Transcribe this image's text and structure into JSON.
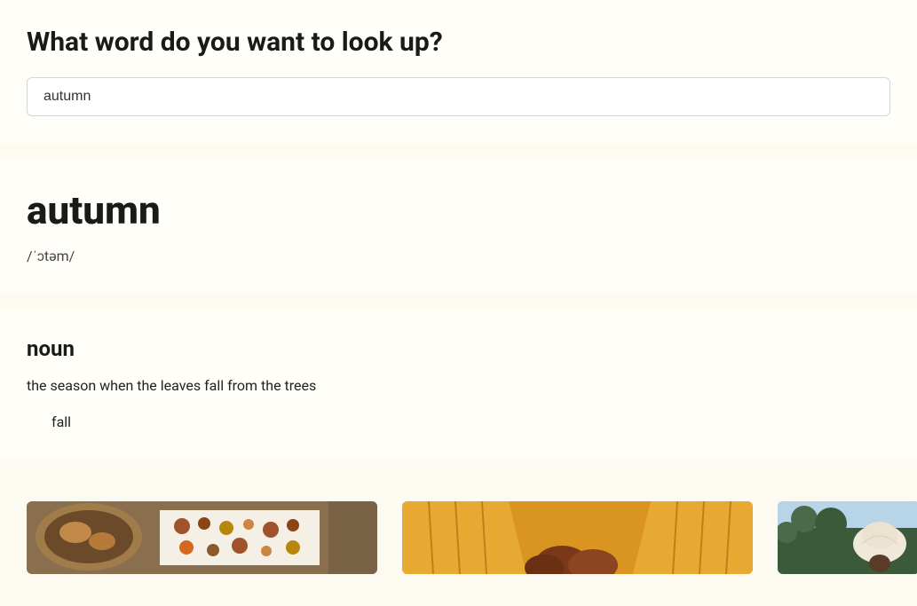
{
  "search": {
    "label": "What word do you want to look up?",
    "value": "autumn"
  },
  "entry": {
    "word": "autumn",
    "pronunciation": "/ˈɔtəm/"
  },
  "definition": {
    "partOfSpeech": "noun",
    "text": "the season when the leaves fall from the trees",
    "synonym": "fall"
  },
  "images": [
    {
      "name": "mushrooms-basket"
    },
    {
      "name": "orange-sweater-holding"
    },
    {
      "name": "person-white-hat"
    }
  ]
}
